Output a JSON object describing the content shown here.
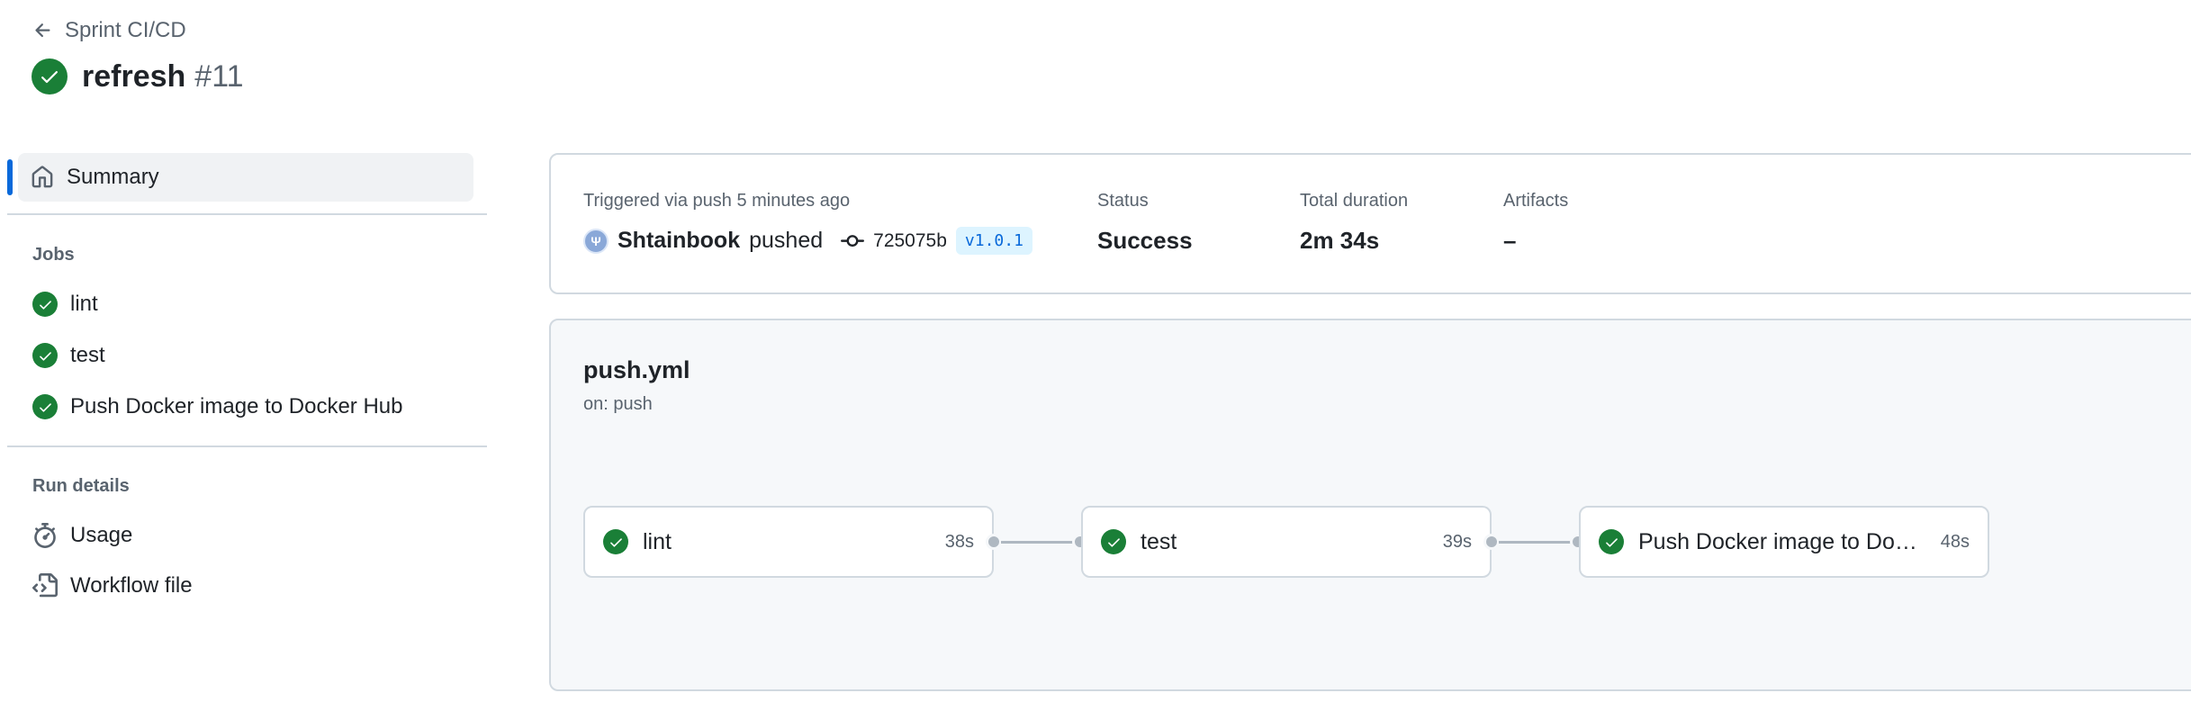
{
  "header": {
    "back_label": "Sprint CI/CD",
    "run_title": "refresh",
    "run_number": "#11"
  },
  "sidebar": {
    "summary_label": "Summary",
    "jobs_heading": "Jobs",
    "jobs": [
      {
        "label": "lint",
        "status": "success"
      },
      {
        "label": "test",
        "status": "success"
      },
      {
        "label": "Push Docker image to Docker Hub",
        "status": "success"
      }
    ],
    "run_details_heading": "Run details",
    "details": [
      {
        "label": "Usage",
        "icon": "stopwatch-icon"
      },
      {
        "label": "Workflow file",
        "icon": "file-code-icon"
      }
    ]
  },
  "summary": {
    "trigger_text": "Triggered via push 5 minutes ago",
    "actor": "Shtainbook",
    "action": "pushed",
    "commit": "725075b",
    "tag": "v1.0.1",
    "status_label": "Status",
    "status_value": "Success",
    "duration_label": "Total duration",
    "duration_value": "2m 34s",
    "artifacts_label": "Artifacts",
    "artifacts_value": "–"
  },
  "workflow": {
    "file": "push.yml",
    "trigger": "on: push",
    "jobs": [
      {
        "name": "lint",
        "duration": "38s",
        "status": "success"
      },
      {
        "name": "test",
        "duration": "39s",
        "status": "success"
      },
      {
        "name": "Push Docker image to Dock...",
        "duration": "48s",
        "status": "success"
      }
    ]
  },
  "colors": {
    "success": "#1a7f37",
    "accent": "#0969da",
    "muted": "#59636e",
    "border": "#d1d9e0"
  }
}
